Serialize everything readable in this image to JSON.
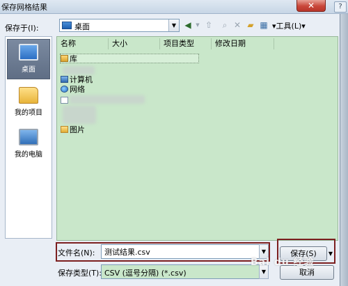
{
  "window": {
    "title": "保存网格结果"
  },
  "toolbar": {
    "save_in_label": "保存于(I):",
    "save_in_value": "桌面",
    "back_icon": "back-arrow-icon",
    "up_icon": "up-folder-icon",
    "search_icon": "search-icon",
    "delete_icon": "delete-icon",
    "new_folder_icon": "new-folder-icon",
    "views_icon": "views-icon",
    "tools_label": "工具(L)"
  },
  "places": [
    {
      "label": "桌面",
      "icon": "desktop-icon",
      "selected": true
    },
    {
      "label": "我的项目",
      "icon": "folder-icon",
      "selected": false
    },
    {
      "label": "我的电脑",
      "icon": "computer-icon",
      "selected": false
    }
  ],
  "filelist": {
    "columns": [
      "名称",
      "大小",
      "项目类型",
      "修改日期"
    ],
    "items": [
      {
        "name": "库",
        "icon": "library-icon"
      },
      {
        "name": "计算机",
        "icon": "computer-icon"
      },
      {
        "name": "网络",
        "icon": "network-icon"
      },
      {
        "name": "",
        "icon": "document-icon"
      },
      {
        "name": "图片",
        "icon": "picture-folder-icon"
      }
    ]
  },
  "filename": {
    "label": "文件名(N):",
    "value": "测试结果.csv"
  },
  "filetype": {
    "label": "保存类型(T):",
    "value": "CSV (逗号分隔) (*.csv)"
  },
  "buttons": {
    "save": "保存(S)",
    "cancel": "取消"
  },
  "watermark": "Bai du 经验"
}
